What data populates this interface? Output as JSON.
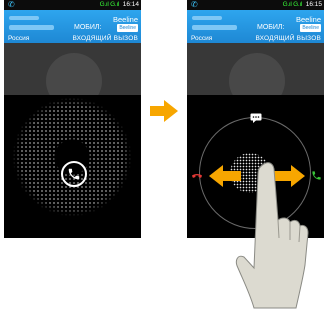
{
  "screens": [
    {
      "status_time": "16:14",
      "operator": "Beeline",
      "call_type": "МОБИЛ:",
      "sim_chip": "Beeline",
      "region": "Россия",
      "call_status": "ВХОДЯЩИЙ ВЫЗОВ"
    },
    {
      "status_time": "16:15",
      "operator": "Beeline",
      "call_type": "МОБИЛ:",
      "sim_chip": "Beeline",
      "region": "Россия",
      "call_status": "ВХОДЯЩИЙ ВЫЗОВ"
    }
  ],
  "signal_text": "G.ıl G.ıl",
  "colors": {
    "header": "#1e88d4",
    "arrow": "#f7a600",
    "end_call": "#e53935",
    "answer_call": "#39c439"
  },
  "icons": [
    "phone-icon",
    "end-call-icon",
    "answer-call-icon",
    "message-icon",
    "arrow-icon",
    "hand-icon"
  ]
}
